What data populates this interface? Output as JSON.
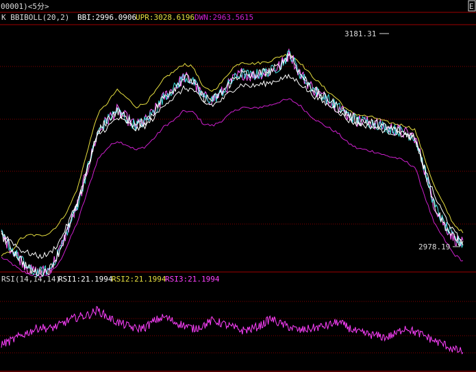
{
  "window": {
    "title": "00001)<5分>",
    "corner_button": "E"
  },
  "main_panel": {
    "indicator_name": "K  BBIBOLL(20,2)",
    "bbi_text": "BBI:2996.0906",
    "upr_text": "UPR:3028.6196",
    "dwn_text": "DWN:2963.5615",
    "high_label": "3181.31",
    "low_label": "2978.19"
  },
  "rsi_panel": {
    "indicator_name": "RSI(14,14,14)",
    "rsi1_text": "RSI1:21.1994",
    "rsi2_text": "RSI2:21.1994",
    "rsi3_text": "RSI3:21.1994"
  },
  "colors": {
    "background": "#000000",
    "frame": "#a00000",
    "grid": "#8a0000",
    "text": "#dcdcdc",
    "upr_line": "#e8e040",
    "bbi_line": "#ffffff",
    "dwn_line": "#d020d0",
    "price_cyan": "#40e0e0",
    "price_white": "#ffffff",
    "price_magenta": "#ff60ff",
    "rsi_line": "#ff40ff"
  },
  "chart_data": [
    {
      "type": "line",
      "panel": "price",
      "title": "BBIBOLL(20,2)",
      "ylim": [
        2950,
        3210
      ],
      "grid": true,
      "series": [
        {
          "name": "UPR",
          "values": [
            2966,
            2970,
            2984,
            2988,
            2987,
            2990,
            3000,
            3016,
            3040,
            3080,
            3116,
            3128,
            3142,
            3134,
            3124,
            3128,
            3140,
            3155,
            3162,
            3170,
            3166,
            3144,
            3141,
            3151,
            3165,
            3172,
            3170,
            3171,
            3173,
            3178,
            3180,
            3172,
            3160,
            3150,
            3140,
            3132,
            3120,
            3116,
            3114,
            3112,
            3108,
            3106,
            3104,
            3100,
            3070,
            3040,
            3020,
            3000,
            2990
          ]
        },
        {
          "name": "BBI",
          "values": [
            2990,
            2982,
            2972,
            2968,
            2965,
            2968,
            2980,
            3002,
            3026,
            3060,
            3094,
            3102,
            3112,
            3108,
            3100,
            3104,
            3114,
            3128,
            3134,
            3144,
            3142,
            3128,
            3126,
            3132,
            3142,
            3148,
            3146,
            3148,
            3150,
            3154,
            3156,
            3150,
            3140,
            3132,
            3126,
            3120,
            3110,
            3106,
            3104,
            3102,
            3098,
            3096,
            3094,
            3090,
            3060,
            3030,
            3010,
            2992,
            2980
          ]
        },
        {
          "name": "DWN",
          "values": [
            2964,
            2958,
            2950,
            2946,
            2944,
            2946,
            2958,
            2980,
            3004,
            3036,
            3068,
            3080,
            3088,
            3084,
            3078,
            3082,
            3092,
            3104,
            3110,
            3120,
            3118,
            3106,
            3104,
            3110,
            3118,
            3124,
            3122,
            3124,
            3126,
            3130,
            3132,
            3126,
            3116,
            3108,
            3102,
            3096,
            3086,
            3080,
            3078,
            3076,
            3072,
            3070,
            3066,
            3060,
            3030,
            3000,
            2984,
            2968,
            2960
          ]
        },
        {
          "name": "price",
          "values": [
            2988,
            2974,
            2962,
            2950,
            2948,
            2951,
            2970,
            2996,
            3022,
            3060,
            3096,
            3110,
            3120,
            3112,
            3104,
            3109,
            3121,
            3136,
            3144,
            3156,
            3150,
            3134,
            3132,
            3140,
            3152,
            3160,
            3157,
            3160,
            3162,
            3168,
            3181.31,
            3160,
            3148,
            3138,
            3132,
            3124,
            3116,
            3110,
            3108,
            3106,
            3102,
            3100,
            3096,
            3092,
            3058,
            3020,
            3000,
            2985,
            2978.19
          ]
        }
      ]
    },
    {
      "type": "line",
      "panel": "rsi",
      "title": "RSI(14,14,14)",
      "ylim": [
        0,
        100
      ],
      "grid": true,
      "series": [
        {
          "name": "RSI1",
          "values": [
            30,
            34,
            40,
            45,
            50,
            48,
            52,
            58,
            62,
            64,
            70,
            62,
            56,
            52,
            48,
            50,
            58,
            62,
            56,
            52,
            48,
            52,
            58,
            54,
            50,
            46,
            48,
            52,
            60,
            54,
            50,
            46,
            48,
            50,
            52,
            56,
            50,
            44,
            42,
            40,
            38,
            42,
            50,
            44,
            40,
            34,
            30,
            24,
            21.1994
          ]
        }
      ]
    }
  ]
}
